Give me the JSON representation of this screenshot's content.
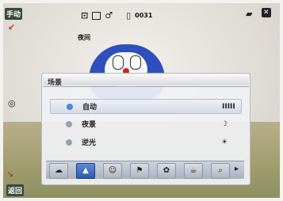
{
  "status_bar": {
    "mode_badge": "手动",
    "top_text": "夜间",
    "counter": "0031",
    "battery_text": "■"
  },
  "side": {
    "bottom_badge": "返回"
  },
  "menu": {
    "title": "场景",
    "options": [
      {
        "label": "自动",
        "icon_text": "IIIII",
        "dot_color": "#4a87dd",
        "selected": true
      },
      {
        "label": "夜景",
        "icon_text": "☽",
        "dot_color": "#9aa0ab",
        "selected": false
      },
      {
        "label": "逆光",
        "icon_text": "☀",
        "dot_color": "#9aa0ab",
        "selected": false
      }
    ],
    "scene_icons": [
      {
        "name": "night-scene-icon",
        "glyph": "☁"
      },
      {
        "name": "landscape-scene-icon",
        "glyph": "▲"
      },
      {
        "name": "portrait-scene-icon",
        "glyph": "☺"
      },
      {
        "name": "sports-scene-icon",
        "glyph": "⚑"
      },
      {
        "name": "flower-scene-icon",
        "glyph": "✿"
      },
      {
        "name": "food-scene-icon",
        "glyph": "☕"
      },
      {
        "name": "macro-scene-icon",
        "glyph": "⌕"
      }
    ],
    "more_arrow": "▸"
  },
  "colors": {
    "accent": "#2d5bb1",
    "panel_bg": "#f0f1f5"
  }
}
